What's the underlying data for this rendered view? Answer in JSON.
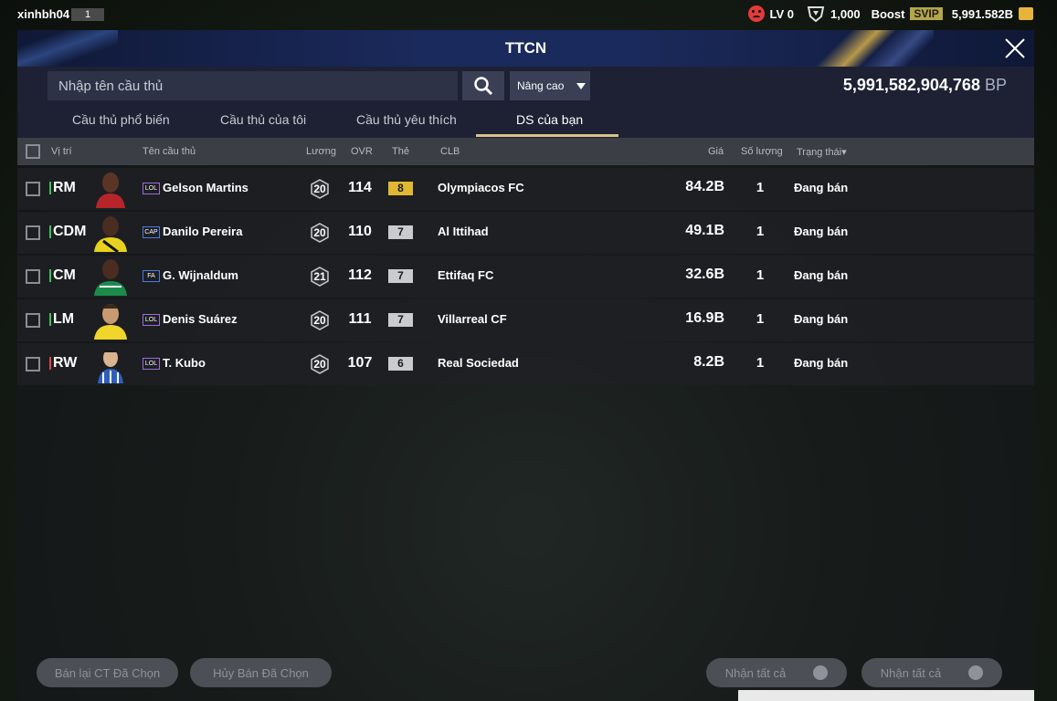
{
  "topbar": {
    "username": "xinhbh04",
    "user_level": "1",
    "lv_label": "LV 0",
    "shield_count": "1,000",
    "boost_label": "Boost",
    "svip_label": "SVIP",
    "coins": "5,991.582B"
  },
  "panel": {
    "title": "TTCN",
    "search_placeholder": "Nhập tên cầu thủ",
    "advanced_label": "Nâng cao",
    "bp_amount": "5,991,582,904,768",
    "bp_unit": "BP"
  },
  "tabs": [
    {
      "label": "Cầu thủ phổ biến",
      "active": false
    },
    {
      "label": "Cầu thủ của tôi",
      "active": false
    },
    {
      "label": "Cầu thủ yêu thích",
      "active": false
    },
    {
      "label": "DS của bạn",
      "active": true
    }
  ],
  "table": {
    "headers": {
      "position": "Vị trí",
      "name": "Tên cầu thủ",
      "salary": "Lương",
      "ovr": "OVR",
      "grade": "Thẻ",
      "club": "CLB",
      "price": "Giá",
      "qty": "Số lượng",
      "status": "Trạng thái▾"
    },
    "rows": [
      {
        "pos": "RM",
        "pos_color": "#3cc45a",
        "badge": "LOL",
        "name": "Gelson Martins",
        "salary": "20",
        "ovr": "114",
        "grade": "8",
        "grade_color": "#e0b832",
        "club": "Olympiacos FC",
        "price": "84.2B",
        "qty": "1",
        "status": "Đang bán"
      },
      {
        "pos": "CDM",
        "pos_color": "#3cc45a",
        "badge": "CAP",
        "name": "Danilo Pereira",
        "salary": "20",
        "ovr": "110",
        "grade": "7",
        "grade_color": "#c9cbd0",
        "club": "Al Ittihad",
        "price": "49.1B",
        "qty": "1",
        "status": "Đang bán"
      },
      {
        "pos": "CM",
        "pos_color": "#3cc45a",
        "badge": "FA",
        "name": "G. Wijnaldum",
        "salary": "21",
        "ovr": "112",
        "grade": "7",
        "grade_color": "#c9cbd0",
        "club": "Ettifaq FC",
        "price": "32.6B",
        "qty": "1",
        "status": "Đang bán"
      },
      {
        "pos": "LM",
        "pos_color": "#3cc45a",
        "badge": "LOL",
        "name": "Denis Suárez",
        "salary": "20",
        "ovr": "111",
        "grade": "7",
        "grade_color": "#c9cbd0",
        "club": "Villarreal CF",
        "price": "16.9B",
        "qty": "1",
        "status": "Đang bán"
      },
      {
        "pos": "RW",
        "pos_color": "#e04545",
        "badge": "LOL",
        "name": "T. Kubo",
        "salary": "20",
        "ovr": "107",
        "grade": "6",
        "grade_color": "#c9cbd0",
        "club": "Real Sociedad",
        "price": "8.2B",
        "qty": "1",
        "status": "Đang bán"
      }
    ]
  },
  "footer": {
    "resell_label": "Bán lại CT Đã Chọn",
    "cancel_label": "Hủy Bán Đã Chọn",
    "claim_all_1": "Nhận tất cả",
    "claim_all_2": "Nhận tất cả"
  }
}
